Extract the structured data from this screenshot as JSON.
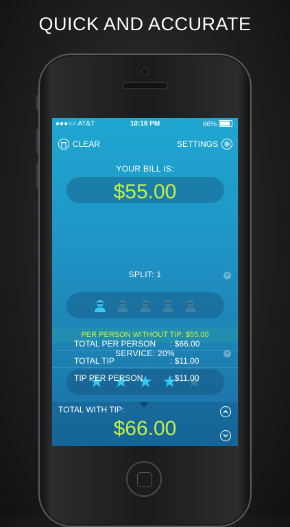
{
  "headline": "QUICK AND ACCURATE",
  "status": {
    "carrier": "●●●○○ AT&T",
    "time": "10:18 PM",
    "battery": "86%"
  },
  "toolbar": {
    "clear_label": "CLEAR",
    "settings_label": "SETTINGS"
  },
  "bill": {
    "label": "YOUR BILL IS:",
    "value": "$55.00"
  },
  "split": {
    "label": "SPLIT: 1",
    "selected_people": 1,
    "total_people": 5
  },
  "per_person_without_tip": "PER PERSON WITHOUT TIP:  $55.00",
  "service": {
    "label": "SERVICE: 20%",
    "rating": 4,
    "max_rating": 5
  },
  "total": {
    "label": "TOTAL WITH TIP:",
    "value": "$66.00"
  },
  "summary": [
    {
      "label": "TOTAL PER PERSON",
      "value": ": $66.00"
    },
    {
      "label": "TOTAL TIP",
      "value": ": $11.00"
    },
    {
      "label": "TIP PER PERSON",
      "value": ": $11.00"
    }
  ],
  "colors": {
    "accent": "#c6f046",
    "star_active": "#35c8f2",
    "star_inactive": "#3f7fa0"
  },
  "icons": {
    "clear": "trash-icon",
    "settings": "gear-icon",
    "up": "chevron-up-icon",
    "down": "chevron-down-icon"
  }
}
